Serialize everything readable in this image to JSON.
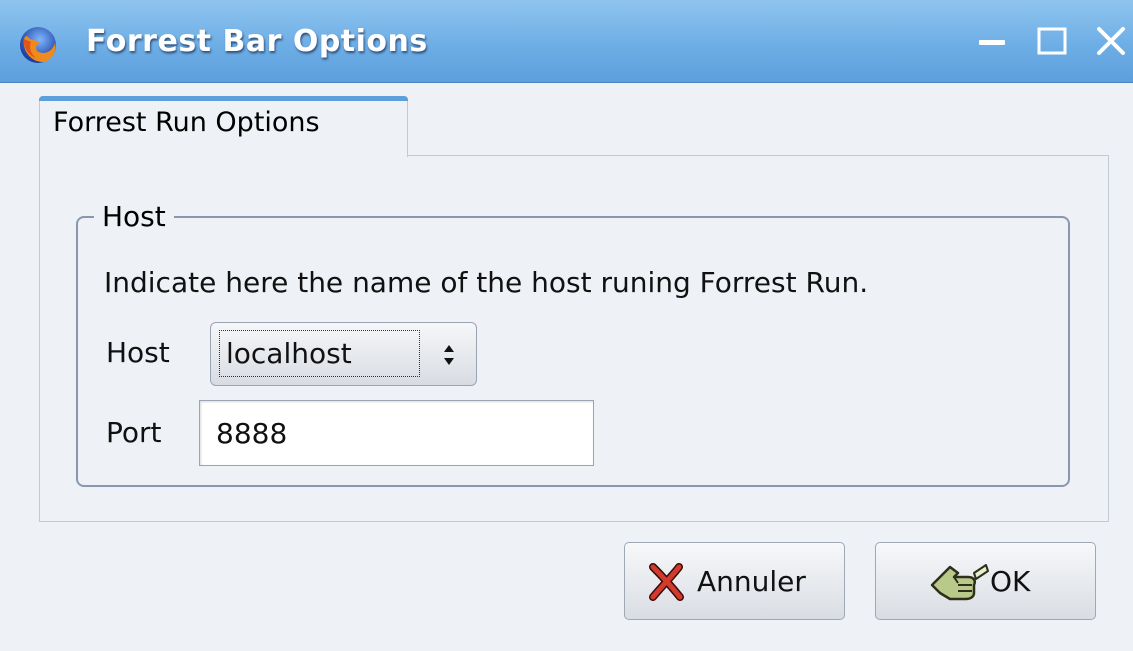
{
  "window": {
    "title": "Forrest Bar Options",
    "app_icon": "firefox-icon",
    "controls": [
      "minimize-icon",
      "maximize-icon",
      "close-icon"
    ],
    "accent_color": "#6eaee6"
  },
  "tabs": [
    {
      "label": "Forrest Run Options",
      "selected": true
    }
  ],
  "host_frame": {
    "legend": "Host",
    "description": "Indicate here the name of the host runing Forrest Run.",
    "host": {
      "label": "Host",
      "value": "localhost"
    },
    "port": {
      "label": "Port",
      "value": "8888"
    }
  },
  "buttons": {
    "cancel": {
      "label": "Annuler",
      "icon": "red-x-cancel-icon"
    },
    "ok": {
      "label": "OK",
      "icon": "hand-pointer-icon"
    }
  }
}
